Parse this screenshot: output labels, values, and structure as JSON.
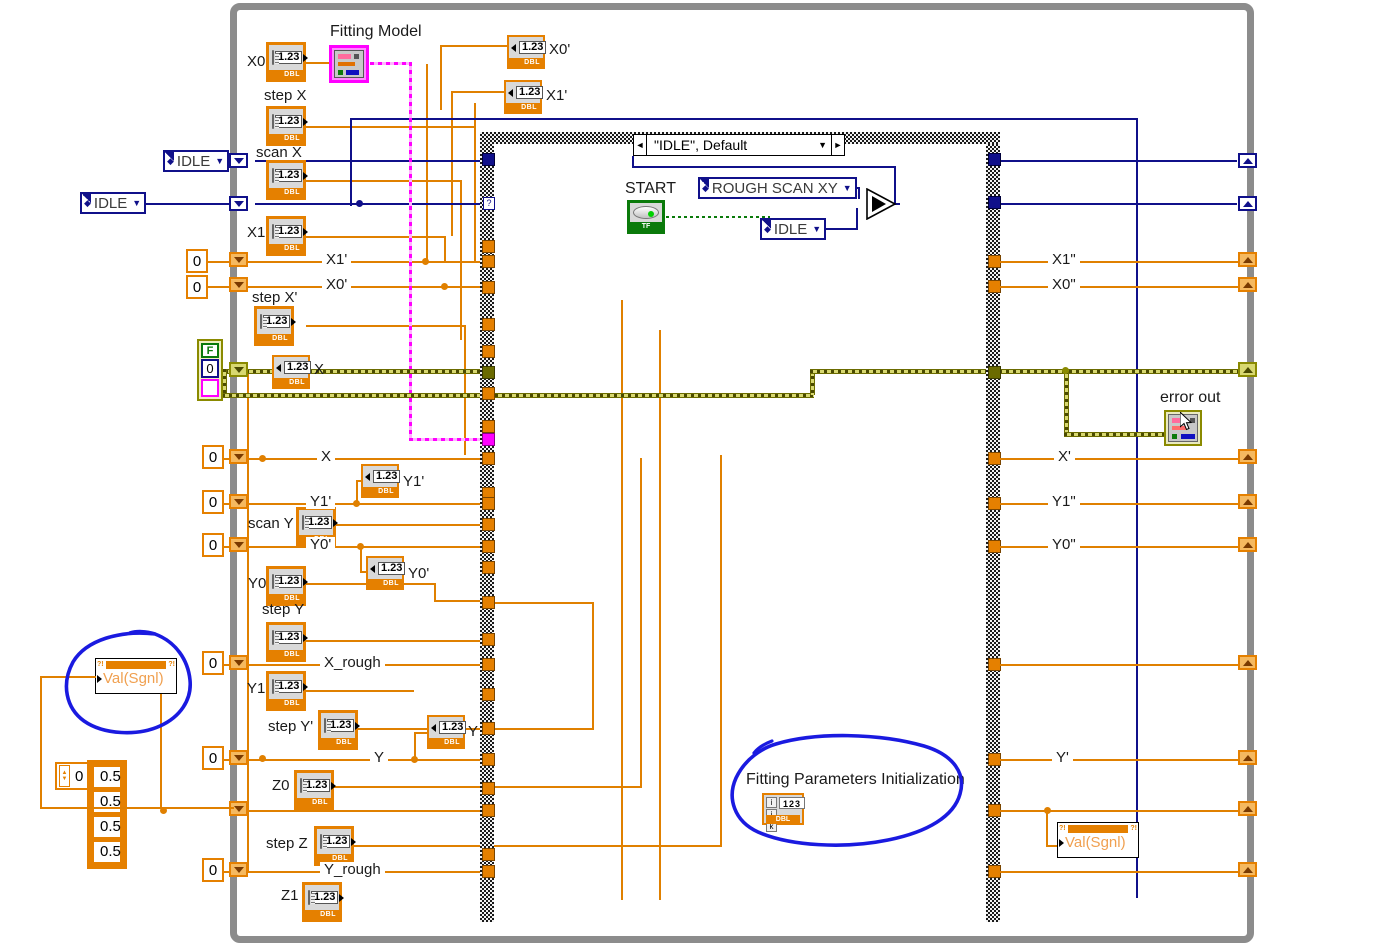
{
  "app": {
    "kind": "labview-block-diagram",
    "colors": {
      "wire_dbl": "#e08000",
      "wire_enum": "#10108a",
      "wire_error": "#8a8a00",
      "wire_refnum": "#ff00ff",
      "wire_boolean": "#0a7a0a",
      "loop_border": "#8c8c8c",
      "ink_annotation": "#1a1ae0",
      "terminal_dbl": "#e58000"
    }
  },
  "case_structure": {
    "selector_label": "\"IDLE\", Default",
    "left_arrow": "◄",
    "right_arrow": "►",
    "dropdown_arrow": "▼",
    "selector_tunnel_glyph": "?"
  },
  "controls": {
    "fitting_model": {
      "label": "Fitting Model",
      "type": "vi-refnum"
    },
    "start_button": {
      "label": "START",
      "type": "boolean",
      "footer": "TF"
    },
    "enum_idle_top": {
      "value": "IDLE"
    },
    "enum_idle_left": {
      "value": "IDLE"
    },
    "enum_rough_scan": {
      "value": "ROUGH SCAN XY"
    },
    "enum_idle_case": {
      "value": "IDLE"
    },
    "dbl_terminals": [
      {
        "label": "X0",
        "value": "1.23",
        "type": "DBL"
      },
      {
        "label": "step X",
        "value": "1.23",
        "type": "DBL"
      },
      {
        "label": "scan X",
        "value": "1.23",
        "type": "DBL"
      },
      {
        "label": "X1",
        "value": "1.23",
        "type": "DBL"
      },
      {
        "label": "step X'",
        "value": "1.23",
        "type": "DBL"
      },
      {
        "label": "scan Y",
        "value": "1.23",
        "type": "DBL"
      },
      {
        "label": "Y0",
        "value": "1.23",
        "type": "DBL"
      },
      {
        "label": "step Y",
        "value": "1.23",
        "type": "DBL"
      },
      {
        "label": "Y1",
        "value": "1.23",
        "type": "DBL"
      },
      {
        "label": "step Y'",
        "value": "1.23",
        "type": "DBL"
      },
      {
        "label": "Z0",
        "value": "1.23",
        "type": "DBL"
      },
      {
        "label": "step Z",
        "value": "1.23",
        "type": "DBL"
      },
      {
        "label": "Z1",
        "value": "1.23",
        "type": "DBL"
      }
    ]
  },
  "indicators": {
    "dbl": [
      {
        "label": "X0'",
        "value": "1.23",
        "type": "DBL"
      },
      {
        "label": "X1'",
        "value": "1.23",
        "type": "DBL"
      },
      {
        "label": "X",
        "value": "1.23",
        "type": "DBL"
      },
      {
        "label": "Y1'",
        "value": "1.23",
        "type": "DBL"
      },
      {
        "label": "Y0'",
        "value": "1.23",
        "type": "DBL"
      },
      {
        "label": "Y",
        "value": "1.23",
        "type": "DBL"
      }
    ],
    "error_out": {
      "label": "error out",
      "type": "error-cluster"
    }
  },
  "wire_labels": {
    "left": [
      "X1'",
      "X0'",
      "X",
      "Y1'",
      "Y0'",
      "X_rough",
      "Y",
      "Y_rough"
    ],
    "right": [
      "X1\"",
      "X0\"",
      "X'",
      "Y1\"",
      "Y0\"",
      "Y'"
    ]
  },
  "constants": {
    "zeros": [
      "0",
      "0",
      "0",
      "0",
      "0",
      "0",
      "0",
      "0",
      "0"
    ],
    "error_cluster": {
      "status": "F",
      "code": "0",
      "source": ""
    },
    "array_constant": {
      "index": "0",
      "elements": [
        "0.5",
        "0.5",
        "0.5",
        "0.5"
      ]
    },
    "fitting_params": {
      "label": "Fitting Parameters Initialization",
      "dims": [
        "i",
        "j",
        "k"
      ],
      "value": "123",
      "type": "DBL"
    }
  },
  "property_nodes": [
    {
      "name": "Val(Sgnl)",
      "marker_left": "?!",
      "marker_right": "?!"
    },
    {
      "name": "Val(Sgnl)",
      "marker_left": "?!",
      "marker_right": "?!"
    }
  ],
  "annotations": [
    {
      "text": "",
      "shape": "hand-drawn-circle",
      "target": "val-signal-property-node"
    },
    {
      "text": "",
      "shape": "hand-drawn-circle",
      "target": "fitting-parameters-initialization"
    }
  ]
}
